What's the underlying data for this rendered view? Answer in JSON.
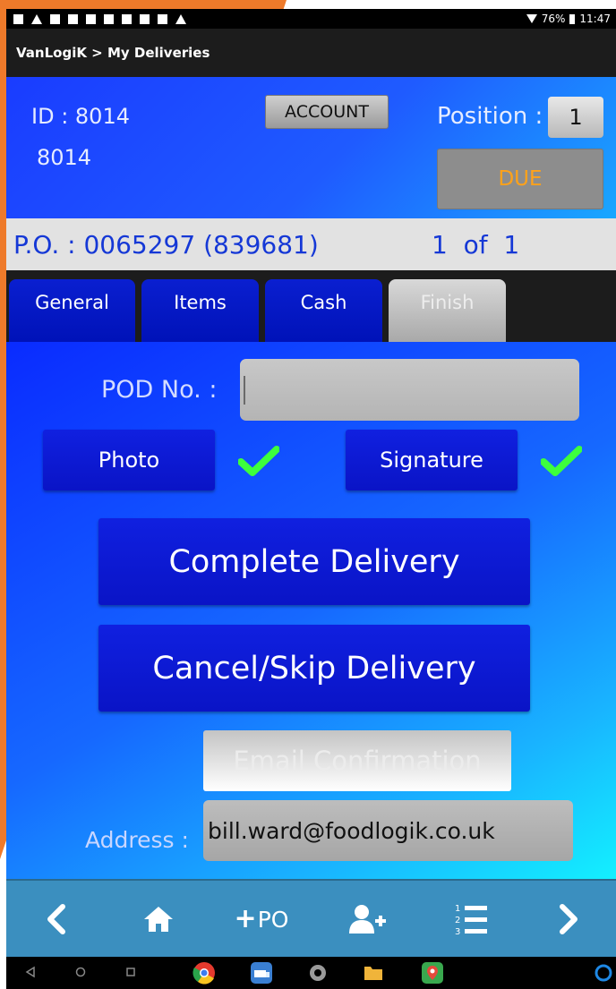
{
  "status_bar": {
    "battery": "76%",
    "time": "11:47"
  },
  "title_bar": {
    "breadcrumb": "VanLogiK > My Deliveries"
  },
  "header": {
    "id_label": "ID : 8014",
    "id_secondary": "8014",
    "account_label": "ACCOUNT",
    "position_label": "Position :",
    "position_value": "1",
    "due_label": "DUE",
    "due_color": "#ffa21a"
  },
  "po_bar": {
    "po_text": "P.O. : 0065297 (839681)",
    "count_text": "1  of  1"
  },
  "tabs": [
    {
      "label": "General",
      "active": false
    },
    {
      "label": "Items",
      "active": false
    },
    {
      "label": "Cash",
      "active": false
    },
    {
      "label": "Finish",
      "active": true
    }
  ],
  "finish": {
    "pod_label": "POD No. :",
    "pod_value": "",
    "photo_label": "Photo",
    "signature_label": "Signature",
    "photo_done": true,
    "signature_done": true,
    "check_color": "#3dff3d",
    "complete_label": "Complete Delivery",
    "cancel_label": "Cancel/Skip Delivery",
    "email_label": "Email Confirmation",
    "address_label": "Address :",
    "address_value": "bill.ward@foodlogik.co.uk"
  },
  "bottom_nav": {
    "items": [
      {
        "name": "back",
        "icon": "chevron-left-icon"
      },
      {
        "name": "home",
        "icon": "home-icon"
      },
      {
        "name": "add-po",
        "icon": "plus-icon",
        "label": "PO"
      },
      {
        "name": "add-user",
        "icon": "user-plus-icon"
      },
      {
        "name": "list",
        "icon": "numbered-list-icon"
      },
      {
        "name": "forward",
        "icon": "chevron-right-icon"
      }
    ]
  },
  "colors": {
    "accent_blue": "#1020e0",
    "nav_bar": "#3b8fbf",
    "orange_deco": "#ee7a2a"
  }
}
